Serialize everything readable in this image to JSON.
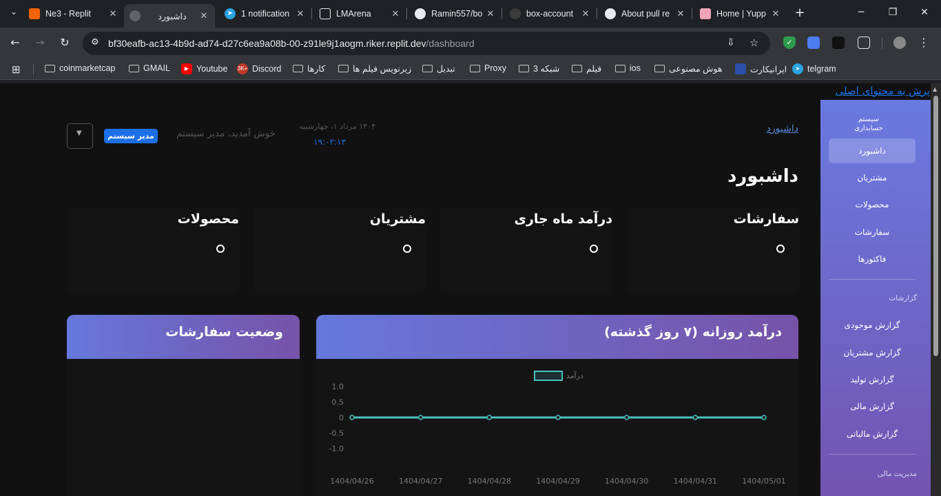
{
  "browser": {
    "tabs": [
      {
        "title": "Ne3 - Replit",
        "icon": "replit-icon"
      },
      {
        "title": "داشبورد",
        "icon": "globe-icon"
      },
      {
        "title": "1 notification",
        "icon": "telegram-icon"
      },
      {
        "title": "LMArena",
        "icon": "lmarena-icon"
      },
      {
        "title": "Ramin557/bo",
        "icon": "github-icon"
      },
      {
        "title": "box-account",
        "icon": "github-icon"
      },
      {
        "title": "About pull re",
        "icon": "github-icon"
      },
      {
        "title": "Home | Yupp",
        "icon": "yupp-icon"
      }
    ],
    "url_host": "bf30eafb-ac13-4b9d-ad74-d27c6ea9a08b-00-z91le9j1aogm.riker.replit.dev",
    "url_path": "/dashboard",
    "bookmarks": [
      {
        "label": "coinmarketcap",
        "icon": "folder"
      },
      {
        "label": "GMAIL",
        "icon": "folder"
      },
      {
        "label": "Youtube",
        "icon": "youtube"
      },
      {
        "label": "Discord",
        "icon": "discord",
        "badge": "3K+"
      },
      {
        "label": "کارها",
        "icon": "folder"
      },
      {
        "label": "زیرنویس فیلم ها",
        "icon": "folder"
      },
      {
        "label": "تبدیل",
        "icon": "folder"
      },
      {
        "label": "Proxy",
        "icon": "folder"
      },
      {
        "label": "شبکه 3",
        "icon": "folder"
      },
      {
        "label": "فیلم",
        "icon": "folder"
      },
      {
        "label": "ios",
        "icon": "folder"
      },
      {
        "label": "هوش مصنوعی",
        "icon": "folder"
      },
      {
        "label": "ایرانیکارت",
        "icon": "iranicard"
      },
      {
        "label": "telgram",
        "icon": "telegram"
      }
    ]
  },
  "page": {
    "skip_link": "پرش به محتوای اصلی",
    "breadcrumb": "داشبورد",
    "title": "داشبورد",
    "greeting": "خوش آمدید، مدیر سیستم",
    "date": "۱۴۰۴ مرداد ۱، چهارشنبه",
    "time": "۱۹:۰۲:۱۳",
    "role_badge": "مدیر سیستم"
  },
  "sidebar": {
    "brand": [
      "سیستم",
      "حسابداری"
    ],
    "items": [
      {
        "label": "داشبورد",
        "active": true
      },
      {
        "label": "مشتریان"
      },
      {
        "label": "محصولات"
      },
      {
        "label": "سفارشات"
      },
      {
        "label": "فاکتورها"
      }
    ],
    "reports_heading": "گزارشات",
    "reports": [
      {
        "label": "گزارش موجودی"
      },
      {
        "label": "گزارش مشتریان"
      },
      {
        "label": "گزارش تولید"
      },
      {
        "label": "گزارش مالی"
      },
      {
        "label": "گزارش مالیاتی"
      }
    ],
    "finance_heading": "مدیریت مالی"
  },
  "stats": [
    {
      "label": "سفارشات",
      "value": "0"
    },
    {
      "label": "درآمد ماه جاری",
      "value": "0"
    },
    {
      "label": "مشتریان",
      "value": "0"
    },
    {
      "label": "محصولات",
      "value": "0"
    }
  ],
  "cards": {
    "revenue_title": "درآمد روزانه (۷ روز گذشته)",
    "orders_title": "وضعیت سفارشات"
  },
  "chart_data": {
    "type": "line",
    "x": [
      "1404/04/26",
      "1404/04/27",
      "1404/04/28",
      "1404/04/29",
      "1404/04/30",
      "1404/04/31",
      "1404/05/01"
    ],
    "series": [
      {
        "name": "درآمد",
        "values": [
          0,
          0,
          0,
          0,
          0,
          0,
          0
        ],
        "color": "#4bc0c0"
      }
    ],
    "y_ticks": [
      "1.0",
      "0.5",
      "0",
      "-0.5",
      "-1.0"
    ],
    "y_tick_values": [
      1,
      0.5,
      0,
      -0.5,
      -1
    ],
    "ylim": [
      -1,
      1
    ],
    "legend": "top",
    "grid": false
  },
  "colors": {
    "accent": "#1d6fe8",
    "sidebar_top": "#6a7ae0",
    "sidebar_bottom": "#7254b0",
    "line": "#4bc0c0"
  }
}
